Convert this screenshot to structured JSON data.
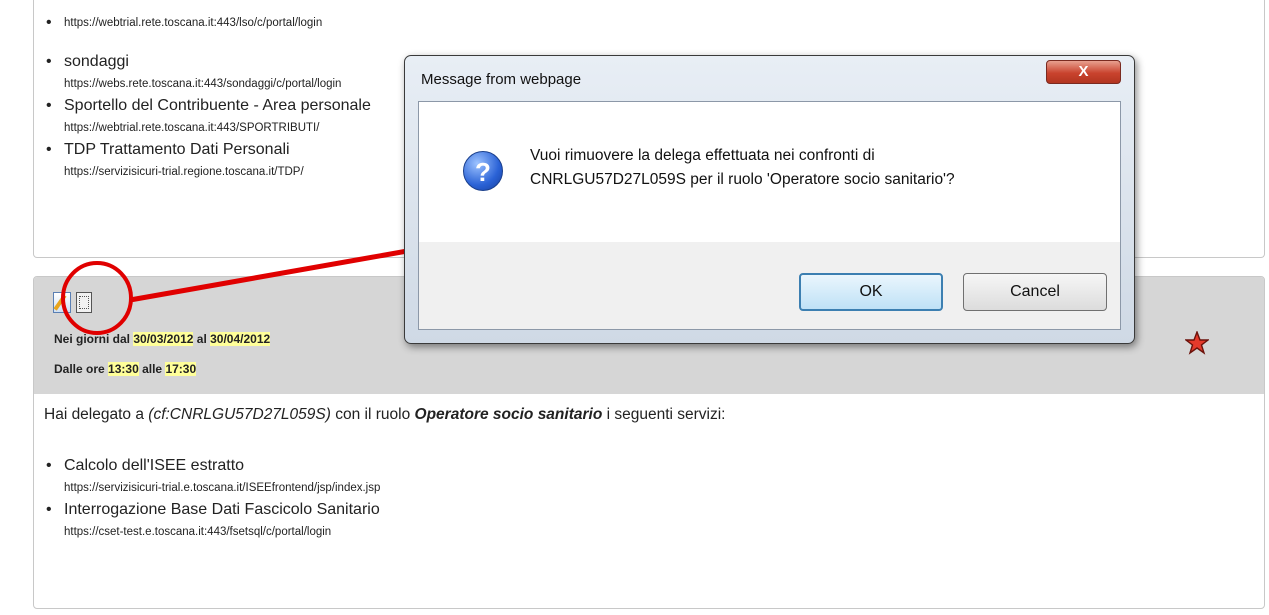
{
  "top_services": [
    {
      "name": "",
      "url": "https://webtrial.rete.toscana.it:443/lso/c/portal/login"
    },
    {
      "name": "sondaggi",
      "url": "https://webs.rete.toscana.it:443/sondaggi/c/portal/login"
    },
    {
      "name": "Sportello del Contribuente - Area personale",
      "url": "https://webtrial.rete.toscana.it:443/SPORTRIBUTI/"
    },
    {
      "name": "TDP Trattamento Dati Personali",
      "url": "https://servizisicuri-trial.regione.toscana.it/TDP/"
    }
  ],
  "delega": {
    "days_prefix": "Nei giorni dal",
    "date_from": "30/03/2012",
    "and_word": "al",
    "date_to": "30/04/2012",
    "hours_prefix": "Dalle ore",
    "time_from": "13:30",
    "hours_mid": "alle",
    "time_to": "17:30",
    "intro_a": "Hai delegato a",
    "cf": "(cf:CNRLGU57D27L059S)",
    "intro_b": "con il ruolo",
    "role": "Operatore socio sanitario",
    "intro_c": "i seguenti servizi:",
    "services": [
      {
        "name": "Calcolo dell'ISEE estratto",
        "url": "https://servizisicuri-trial.e.toscana.it/ISEEfrontend/jsp/index.jsp"
      },
      {
        "name": "Interrogazione Base Dati Fascicolo Sanitario",
        "url": "https://cset-test.e.toscana.it:443/fsetsql/c/portal/login"
      }
    ]
  },
  "dialog": {
    "title": "Message from webpage",
    "close": "X",
    "question_glyph": "?",
    "line1": "Vuoi rimuovere la delega effettuata nei confronti di",
    "line2": "CNRLGU57D27L059S per il ruolo 'Operatore socio sanitario'?",
    "ok": "OK",
    "cancel": "Cancel"
  },
  "colors": {
    "highlight": "#ffff99",
    "annotation": "#e00000",
    "band": "#d6d6d6"
  }
}
